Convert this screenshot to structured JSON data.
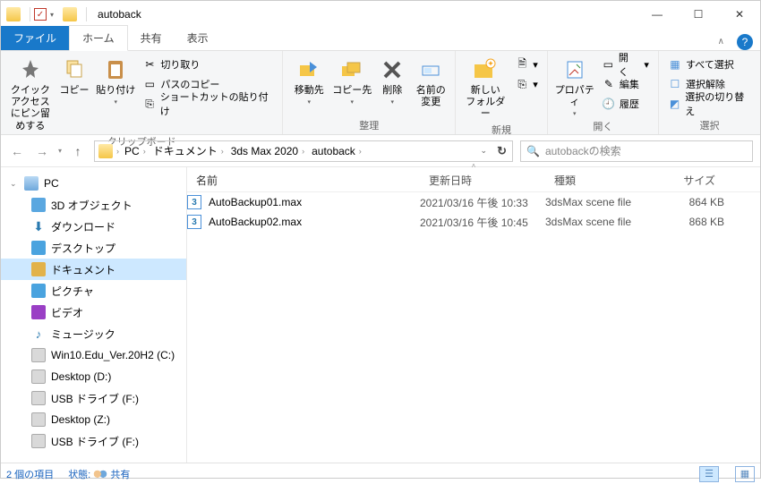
{
  "window": {
    "title": "autoback"
  },
  "tabs": {
    "file": "ファイル",
    "home": "ホーム",
    "share": "共有",
    "view": "表示"
  },
  "ribbon": {
    "clipboard": {
      "pin": "クイック アクセス\nにピン留めする",
      "copy": "コピー",
      "paste": "貼り付け",
      "cut": "切り取り",
      "copypath": "パスのコピー",
      "shortcut": "ショートカットの貼り付け",
      "label": "クリップボード"
    },
    "organize": {
      "moveto": "移動先",
      "copyto": "コピー先",
      "delete": "削除",
      "rename": "名前の\n変更",
      "label": "整理"
    },
    "new": {
      "newfolder": "新しい\nフォルダー",
      "newitem": "",
      "label": "新規"
    },
    "open": {
      "properties": "プロパティ",
      "open": "開く",
      "edit": "編集",
      "history": "履歴",
      "label": "開く"
    },
    "select": {
      "all": "すべて選択",
      "none": "選択解除",
      "invert": "選択の切り替え",
      "label": "選択"
    }
  },
  "breadcrumb": [
    "PC",
    "ドキュメント",
    "3ds Max 2020",
    "autoback"
  ],
  "search": {
    "placeholder": "autobackの検索"
  },
  "columns": {
    "name": "名前",
    "date": "更新日時",
    "type": "種類",
    "size": "サイズ"
  },
  "tree": {
    "root": "PC",
    "items": [
      {
        "label": "3D オブジェクト",
        "icon": "3d"
      },
      {
        "label": "ダウンロード",
        "icon": "dl"
      },
      {
        "label": "デスクトップ",
        "icon": "desk"
      },
      {
        "label": "ドキュメント",
        "icon": "doc",
        "selected": true
      },
      {
        "label": "ピクチャ",
        "icon": "pic"
      },
      {
        "label": "ビデオ",
        "icon": "vid"
      },
      {
        "label": "ミュージック",
        "icon": "music"
      },
      {
        "label": "Win10.Edu_Ver.20H2 (C:)",
        "icon": "drive"
      },
      {
        "label": "Desktop (D:)",
        "icon": "drive"
      },
      {
        "label": "USB ドライブ (F:)",
        "icon": "drive"
      },
      {
        "label": "Desktop (Z:)",
        "icon": "drive"
      },
      {
        "label": "USB ドライブ (F:)",
        "icon": "drive"
      }
    ]
  },
  "files": [
    {
      "name": "AutoBackup01.max",
      "date": "2021/03/16 午後 10:33",
      "type": "3dsMax scene file",
      "size": "864 KB"
    },
    {
      "name": "AutoBackup02.max",
      "date": "2021/03/16 午後 10:45",
      "type": "3dsMax scene file",
      "size": "868 KB"
    }
  ],
  "status": {
    "count": "2 個の項目",
    "state_label": "状態:",
    "state_value": "共有"
  }
}
